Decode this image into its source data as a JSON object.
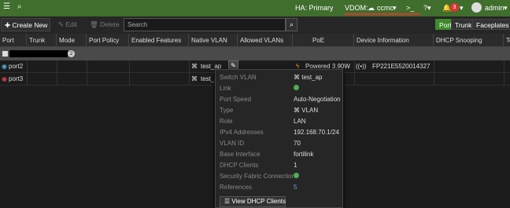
{
  "topbar": {
    "ha_status": "HA: Primary",
    "vdom_label": "VDOM:",
    "vdom_value": "ccmc",
    "notification_count": "3",
    "user": "admin",
    "accent_color": "#3f6e2d"
  },
  "toolbar": {
    "create_label": "Create New",
    "edit_label": "Edit",
    "delete_label": "Delete",
    "search_placeholder": "Search",
    "views": [
      "Port",
      "Trunk",
      "Faceplates"
    ]
  },
  "table": {
    "columns": [
      "Port",
      "Trunk",
      "Mode",
      "Port Policy",
      "Enabled Features",
      "Native VLAN",
      "Allowed VLANs",
      "PoE",
      "Device Information",
      "DHCP Snooping",
      "Te"
    ],
    "group_count": "2",
    "rows": [
      {
        "port": "port2",
        "native_vlan": "test_ap",
        "poe": "Powered 3.90W",
        "device": "FP221E5520014327"
      },
      {
        "port": "port3",
        "native_vlan": "test_a",
        "poe": "",
        "device": ""
      }
    ]
  },
  "popup": {
    "rows": [
      {
        "label": "Switch VLAN",
        "value": "test_ap"
      },
      {
        "label": "Link",
        "value": ""
      },
      {
        "label": "Port Speed",
        "value": "Auto-Negotiation"
      },
      {
        "label": "Type",
        "value": "VLAN"
      },
      {
        "label": "Role",
        "value": "LAN"
      },
      {
        "label": "IPv4 Addresses",
        "value": "192.168.70.1/24"
      },
      {
        "label": "VLAN ID",
        "value": "70"
      },
      {
        "label": "Base Interface",
        "value": "fortilink"
      },
      {
        "label": "DHCP Clients",
        "value": "1"
      },
      {
        "label": "Security Fabric Connection",
        "value": ""
      },
      {
        "label": "References",
        "value": "5"
      }
    ],
    "button_label": "View DHCP Clients"
  }
}
